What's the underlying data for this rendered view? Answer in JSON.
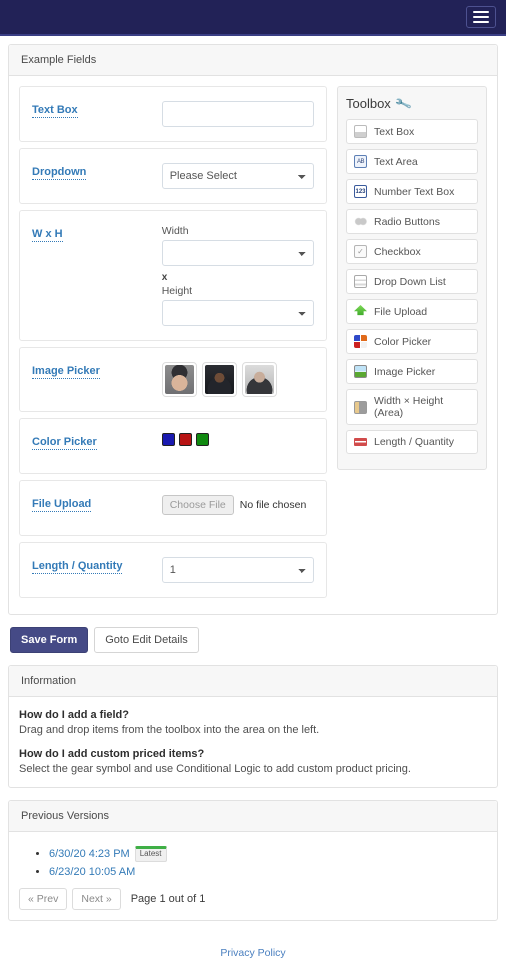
{
  "navbar": {
    "menu_toggle_label": "Toggle navigation",
    "background_color": "#222257"
  },
  "example_fields_panel": {
    "heading": "Example Fields",
    "fields": [
      {
        "label": "Text Box",
        "type": "text",
        "value": "",
        "placeholder": ""
      },
      {
        "label": "Dropdown",
        "type": "select",
        "selected": "Please Select"
      },
      {
        "label": "W x H",
        "type": "area",
        "width_label": "Width",
        "width_value": "",
        "separator": "x",
        "height_label": "Height",
        "height_value": ""
      },
      {
        "label": "Image Picker",
        "type": "images"
      },
      {
        "label": "Color Picker",
        "type": "colors"
      },
      {
        "label": "File Upload",
        "type": "file",
        "button_label": "Choose File",
        "status_text": "No file chosen"
      },
      {
        "label": "Length / Quantity",
        "type": "select",
        "selected": "1"
      }
    ],
    "image_options": [
      {
        "name": "image-option-1"
      },
      {
        "name": "image-option-2"
      },
      {
        "name": "image-option-3"
      }
    ],
    "color_options": [
      {
        "name": "color-blue",
        "hex": "#1a1ab0"
      },
      {
        "name": "color-red",
        "hex": "#b81414"
      },
      {
        "name": "color-green",
        "hex": "#108a10"
      }
    ]
  },
  "toolbox": {
    "title": "Toolbox",
    "icon": "wrench-icon",
    "items": [
      {
        "label": "Text Box",
        "icon": "text-box-icon"
      },
      {
        "label": "Text Area",
        "icon": "text-area-icon"
      },
      {
        "label": "Number Text Box",
        "icon": "number-text-box-icon"
      },
      {
        "label": "Radio Buttons",
        "icon": "radio-buttons-icon"
      },
      {
        "label": "Checkbox",
        "icon": "checkbox-icon"
      },
      {
        "label": "Drop Down List",
        "icon": "drop-down-list-icon"
      },
      {
        "label": "File Upload",
        "icon": "file-upload-icon"
      },
      {
        "label": "Color Picker",
        "icon": "color-picker-icon"
      },
      {
        "label": "Image Picker",
        "icon": "image-picker-icon"
      },
      {
        "label": "Width × Height (Area)",
        "icon": "area-icon"
      },
      {
        "label": "Length / Quantity",
        "icon": "length-quantity-icon"
      }
    ]
  },
  "actions": {
    "save_label": "Save Form",
    "edit_details_label": "Goto Edit Details"
  },
  "information_panel": {
    "heading": "Information",
    "entries": [
      {
        "question": "How do I add a field?",
        "answer": "Drag and drop items from the toolbox into the area on the left."
      },
      {
        "question": "How do I add custom priced items?",
        "answer": "Select the gear symbol and use Conditional Logic to add custom product pricing."
      }
    ]
  },
  "previous_versions_panel": {
    "heading": "Previous Versions",
    "versions": [
      {
        "timestamp": "6/30/20 4:23 PM",
        "badge": "Latest"
      },
      {
        "timestamp": "6/23/20 10:05 AM",
        "badge": ""
      }
    ],
    "pager": {
      "prev_label": "« Prev",
      "next_label": "Next »",
      "page_text": "Page 1 out of 1"
    }
  },
  "footer": {
    "privacy_label": "Privacy Policy"
  }
}
